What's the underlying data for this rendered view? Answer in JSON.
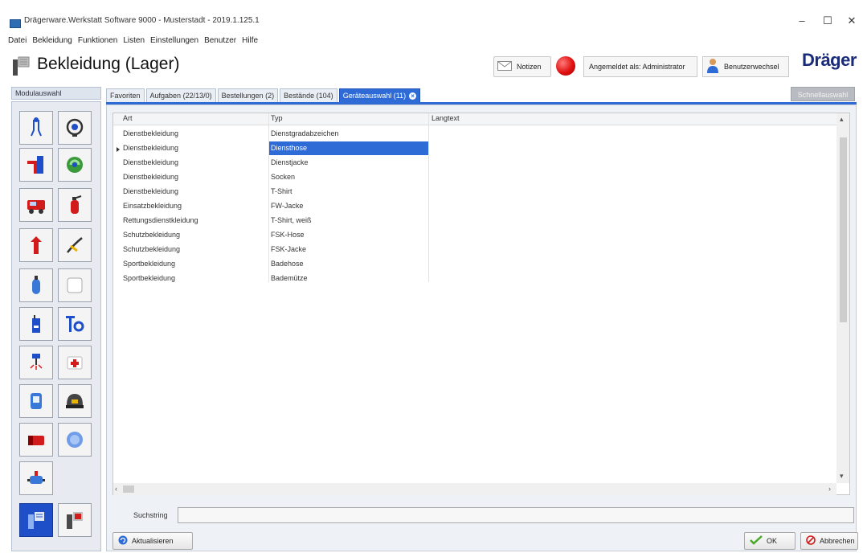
{
  "window": {
    "title": "Drägerware.Werkstatt Software 9000 - Musterstadt - 2019.1.125.1",
    "minimize": "–",
    "maximize": "☐",
    "close": "✕"
  },
  "menu": [
    "Datei",
    "Bekleidung",
    "Funktionen",
    "Listen",
    "Einstellungen",
    "Benutzer",
    "Hilfe"
  ],
  "header": {
    "title": "Bekleidung (Lager)",
    "notes_label": "Notizen",
    "logged_in_label": "Angemeldet als: Administrator",
    "user_switch_label": "Benutzerwechsel",
    "brand": "Dräger",
    "status_color": "#e01010"
  },
  "module_panel": {
    "header": "Modulauswahl",
    "icons": [
      "breathing-apparatus-icon",
      "mask-icon",
      "ladder-icon",
      "gas-detector-icon",
      "fire-truck-icon",
      "extinguisher-icon",
      "hydrant-icon",
      "hose-nozzle-icon",
      "gas-cylinder-icon",
      "blank-module-icon",
      "radio-icon",
      "tools-icon",
      "sprinkler-icon",
      "first-aid-icon",
      "measuring-device-icon",
      "helmet-icon",
      "camera-icon",
      "sensor-icon",
      "pump-icon",
      "clothing-icon",
      "clothing-storage-icon"
    ],
    "selected": "clothing-icon"
  },
  "tabs": [
    {
      "label": "Favoriten"
    },
    {
      "label": "Aufgaben (22/13/0)"
    },
    {
      "label": "Bestellungen (2)"
    },
    {
      "label": "Bestände (104)"
    },
    {
      "label": "Geräteauswahl (11)",
      "active": true
    }
  ],
  "quick_select_label": "Schnellauswahl",
  "grid": {
    "columns": [
      "Art",
      "Typ",
      "Langtext"
    ],
    "rows": [
      [
        "Dienstbekleidung",
        "Dienstgradabzeichen",
        ""
      ],
      [
        "Dienstbekleidung",
        "Diensthose",
        ""
      ],
      [
        "Dienstbekleidung",
        "Dienstjacke",
        ""
      ],
      [
        "Dienstbekleidung",
        "Socken",
        ""
      ],
      [
        "Dienstbekleidung",
        "T-Shirt",
        ""
      ],
      [
        "Einsatzbekleidung",
        "FW-Jacke",
        ""
      ],
      [
        "Rettungsdienstkleidung",
        "T-Shirt, weiß",
        ""
      ],
      [
        "Schutzbekleidung",
        "FSK-Hose",
        ""
      ],
      [
        "Schutzbekleidung",
        "FSK-Jacke",
        ""
      ],
      [
        "Sportbekleidung",
        "Badehose",
        ""
      ],
      [
        "Sportbekleidung",
        "Bademütze",
        ""
      ]
    ],
    "selected_row": 1,
    "accent": "#2f6bd6"
  },
  "search": {
    "label": "Suchstring",
    "value": ""
  },
  "buttons": {
    "refresh": "Aktualisieren",
    "ok": "OK",
    "cancel": "Abbrechen"
  }
}
